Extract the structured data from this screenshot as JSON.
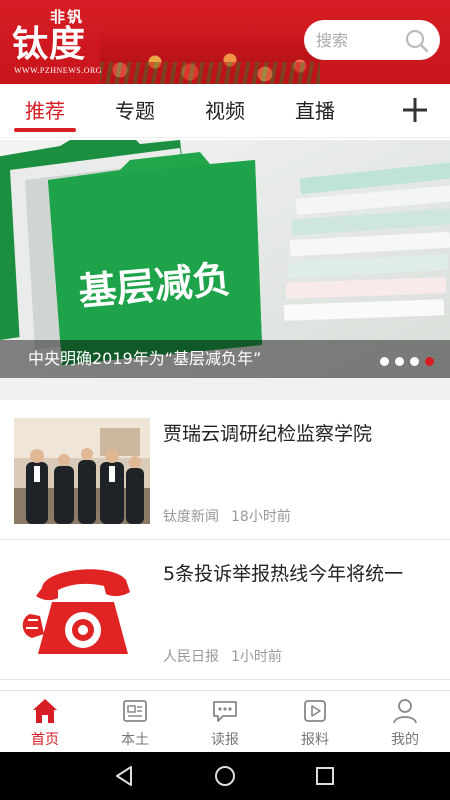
{
  "header": {
    "logo_small": "非钒",
    "logo_big": "钛度",
    "logo_url": "WWW.PZHNEWS.ORG",
    "search_placeholder": "搜索"
  },
  "tabs": [
    {
      "label": "推荐",
      "active": true
    },
    {
      "label": "专题",
      "active": false
    },
    {
      "label": "视频",
      "active": false
    },
    {
      "label": "直播",
      "active": false
    }
  ],
  "banner": {
    "image_text": "基层减负",
    "caption": "中央明确2019年为“基层减负年”",
    "slide_count": 4,
    "active_slide": 4
  },
  "news": [
    {
      "title": "贾瑞云调研纪检监察学院",
      "source": "钛度新闻",
      "time": "18小时前",
      "thumb_icon": "meeting-photo"
    },
    {
      "title": "5条投诉举报热线今年将统一",
      "source": "人民日报",
      "time": "1小时前",
      "thumb_icon": "telephone-icon"
    }
  ],
  "bottom_nav": [
    {
      "label": "首页",
      "icon": "home-icon",
      "active": true
    },
    {
      "label": "本土",
      "icon": "local-news-icon",
      "active": false
    },
    {
      "label": "读报",
      "icon": "read-paper-icon",
      "active": false
    },
    {
      "label": "报料",
      "icon": "report-video-icon",
      "active": false
    },
    {
      "label": "我的",
      "icon": "profile-icon",
      "active": false
    }
  ],
  "colors": {
    "accent": "#d61d24",
    "header_bg": "#c8141b",
    "folder_green": "#1fa34a"
  }
}
